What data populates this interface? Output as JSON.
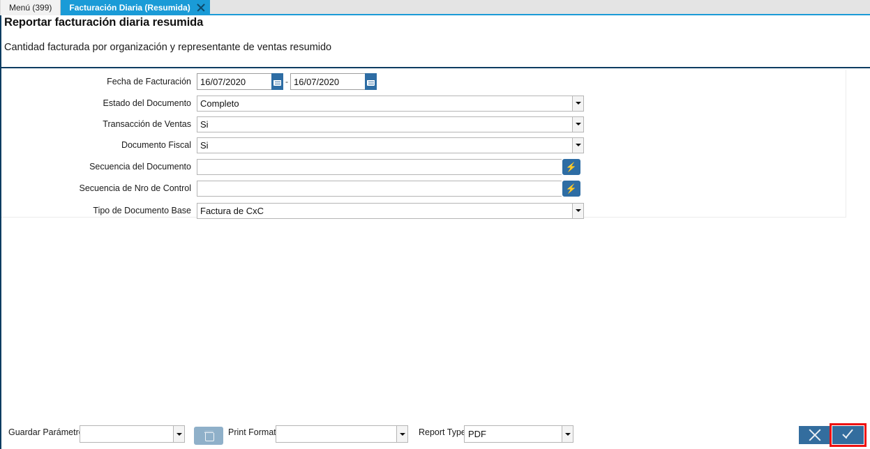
{
  "tabs": [
    {
      "label": "Menú (399)",
      "active": false,
      "closable": false
    },
    {
      "label": "Facturación Diaria (Resumida)",
      "active": true,
      "closable": true
    }
  ],
  "header": {
    "title": "Reportar facturación diaria resumida",
    "subtitle": "Cantidad facturada por organización y representante de ventas resumido"
  },
  "form": {
    "fields": [
      {
        "label": "Fecha de Facturación",
        "type": "date-range",
        "value_from": "16/07/2020",
        "value_to": "16/07/2020",
        "separator": "-",
        "icon": "calendar-icon"
      },
      {
        "label": "Estado del Documento",
        "type": "combo",
        "value": "Completo",
        "icon": "chevron-down-icon"
      },
      {
        "label": "Transacción de Ventas",
        "type": "combo",
        "value": "Si",
        "icon": "chevron-down-icon"
      },
      {
        "label": "Documento Fiscal",
        "type": "combo",
        "value": "Si",
        "icon": "chevron-down-icon"
      },
      {
        "label": "Secuencia del Documento",
        "type": "lookup",
        "value": "",
        "icon": "lightning-icon"
      },
      {
        "label": "Secuencia de Nro de Control",
        "type": "lookup",
        "value": "",
        "icon": "lightning-icon"
      },
      {
        "label": "Tipo de Documento Base",
        "type": "combo",
        "value": "Factura de CxC",
        "icon": "chevron-down-icon"
      }
    ]
  },
  "bottom_bar": {
    "save_param_label": "Guardar Parámetro",
    "save_param_value": "",
    "delete_icon": "trash-icon",
    "print_format_label": "Print Format",
    "print_format_value": "",
    "report_type_label": "Report Type",
    "report_type_value": "PDF",
    "cancel_icon": "close-x-icon",
    "ok_icon": "check-icon"
  },
  "colors": {
    "tab_active": "#1a9bd7",
    "tab_strip": "#e4e4e4",
    "header_rule": "#0d3c61",
    "button_blue": "#2e6da4",
    "action_blue": "#336d9e",
    "focus_outline": "#ee1111",
    "disabled_blue": "#8fb0c9"
  }
}
